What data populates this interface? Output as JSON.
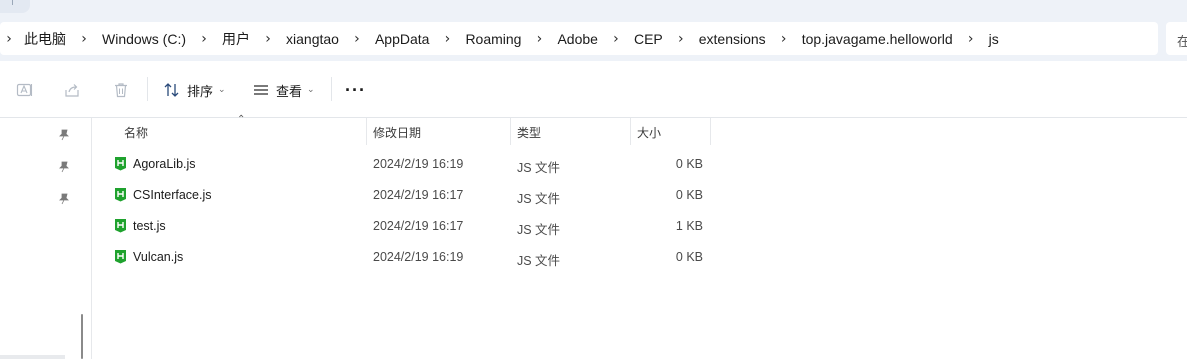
{
  "breadcrumb": [
    "此电脑",
    "Windows (C:)",
    "用户",
    "xiangtao",
    "AppData",
    "Roaming",
    "Adobe",
    "CEP",
    "extensions",
    "top.javagame.helloworld",
    "js"
  ],
  "breadcrumb_separator": "›",
  "search_placeholder": "在",
  "toolbar": {
    "sort_label": "排序",
    "view_label": "查看",
    "more_label": "···",
    "chevron": "⌄"
  },
  "columns": {
    "name": "名称",
    "date": "修改日期",
    "type": "类型",
    "size": "大小",
    "sort_caret": "⌃"
  },
  "files": [
    {
      "name": "AgoraLib.js",
      "date": "2024/2/19 16:19",
      "type": "JS 文件",
      "size": "0 KB"
    },
    {
      "name": "CSInterface.js",
      "date": "2024/2/19 16:17",
      "type": "JS 文件",
      "size": "0 KB"
    },
    {
      "name": "test.js",
      "date": "2024/2/19 16:17",
      "type": "JS 文件",
      "size": "1 KB"
    },
    {
      "name": "Vulcan.js",
      "date": "2024/2/19 16:19",
      "type": "JS 文件",
      "size": "0 KB"
    }
  ],
  "icons": {
    "file": "js-file-icon",
    "pin": "pin-icon",
    "rename": "rename-icon",
    "share": "share-icon",
    "delete": "delete-icon",
    "sort": "sort-icon",
    "view": "view-icon"
  },
  "colors": {
    "accent": "#eef2f8",
    "file_icon_green": "#1fa22e"
  }
}
